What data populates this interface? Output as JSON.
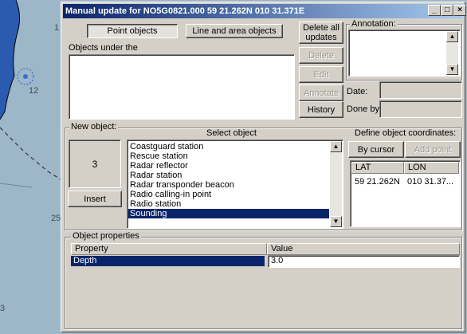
{
  "window": {
    "title": "Manual update for NO5G0821.000  59 21.262N  010 31.371E"
  },
  "title_buttons": {
    "minimize": "_",
    "maximize": "□",
    "close": "×"
  },
  "background_chart": {
    "depth_label_1": "12",
    "depth_label_2": "1",
    "depth_label_3": "25",
    "depth_label_4": "3"
  },
  "tabs": {
    "point_objects": "Point objects",
    "line_area_objects": "Line and area objects"
  },
  "objects_under": {
    "label": "Objects under the"
  },
  "actions": {
    "delete_all_updates": "Delete all updates",
    "delete": "Delete",
    "edit": "Edit",
    "annotate": "Annotate",
    "history": "History"
  },
  "annotation": {
    "label": "Annotation:"
  },
  "date": {
    "label": "Date:",
    "value": ""
  },
  "done_by": {
    "label": "Done by:",
    "value": ""
  },
  "new_object": {
    "group_title": "New object:",
    "count_value": "3",
    "insert_label": "Insert",
    "select_title": "Select object",
    "items": [
      "Coastguard station",
      "Rescue station",
      "Radar reflector",
      "Radar station",
      "Radar transponder beacon",
      "Radio calling-in point",
      "Radio station",
      "Sounding"
    ],
    "selected_item": "Sounding"
  },
  "coordinates": {
    "title": "Define object coordinates:",
    "by_cursor": "By cursor",
    "add_point": "Add point",
    "columns": [
      "LAT",
      "LON"
    ],
    "rows": [
      {
        "lat": "59 21.262N",
        "lon": "010 31.37..."
      }
    ]
  },
  "object_properties": {
    "group_title": "Object properties",
    "columns": [
      "Property",
      "Value"
    ],
    "rows": [
      {
        "property": "Depth",
        "value": "3.0"
      }
    ]
  },
  "colors": {
    "title_bar": "#0a246a",
    "selection": "#0a246a",
    "dialog_bg": "#d4d0c8",
    "chart_water": "#9db6c8",
    "land": "#1f4fa8"
  }
}
